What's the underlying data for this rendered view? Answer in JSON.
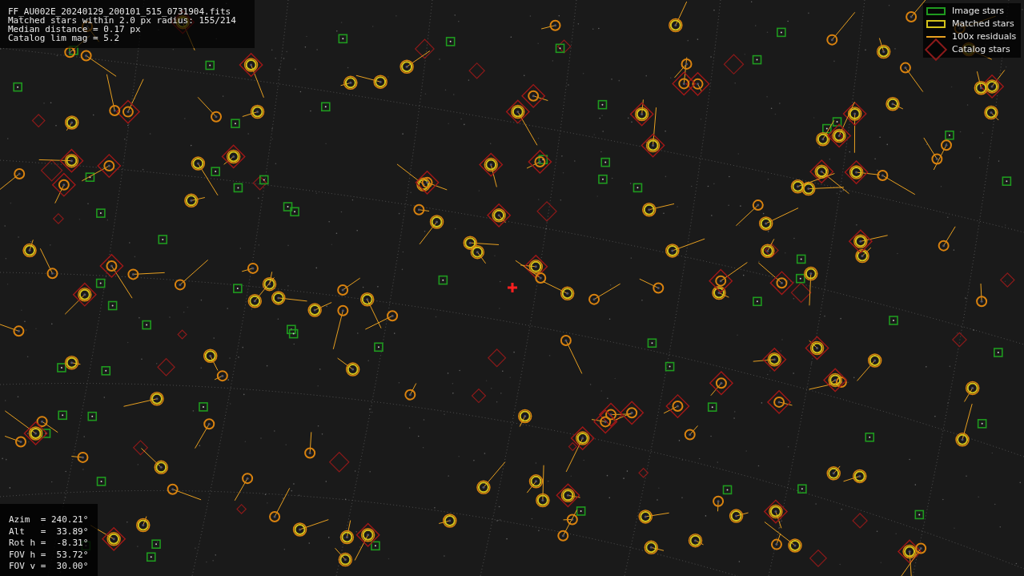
{
  "info": {
    "lines": [
      "FF_AU002E_20240129_200101_515_0731904.fits",
      "Matched stars within 2.0 px radius: 155/214",
      "Median distance = 0.17 px",
      "Catalog lim mag = 5.2"
    ]
  },
  "legend": [
    {
      "kind": "image",
      "label": "Image stars"
    },
    {
      "kind": "matched",
      "label": "Matched stars"
    },
    {
      "kind": "residual",
      "label": "100x residuals"
    },
    {
      "kind": "catalog",
      "label": "Catalog stars"
    }
  ],
  "pointing": {
    "lines": [
      "Azim  = 240.21°",
      "Alt   =  33.89°",
      "Rot h =  -8.31°",
      "FOV h =  53.72°",
      "FOV v =  30.00°"
    ]
  }
}
